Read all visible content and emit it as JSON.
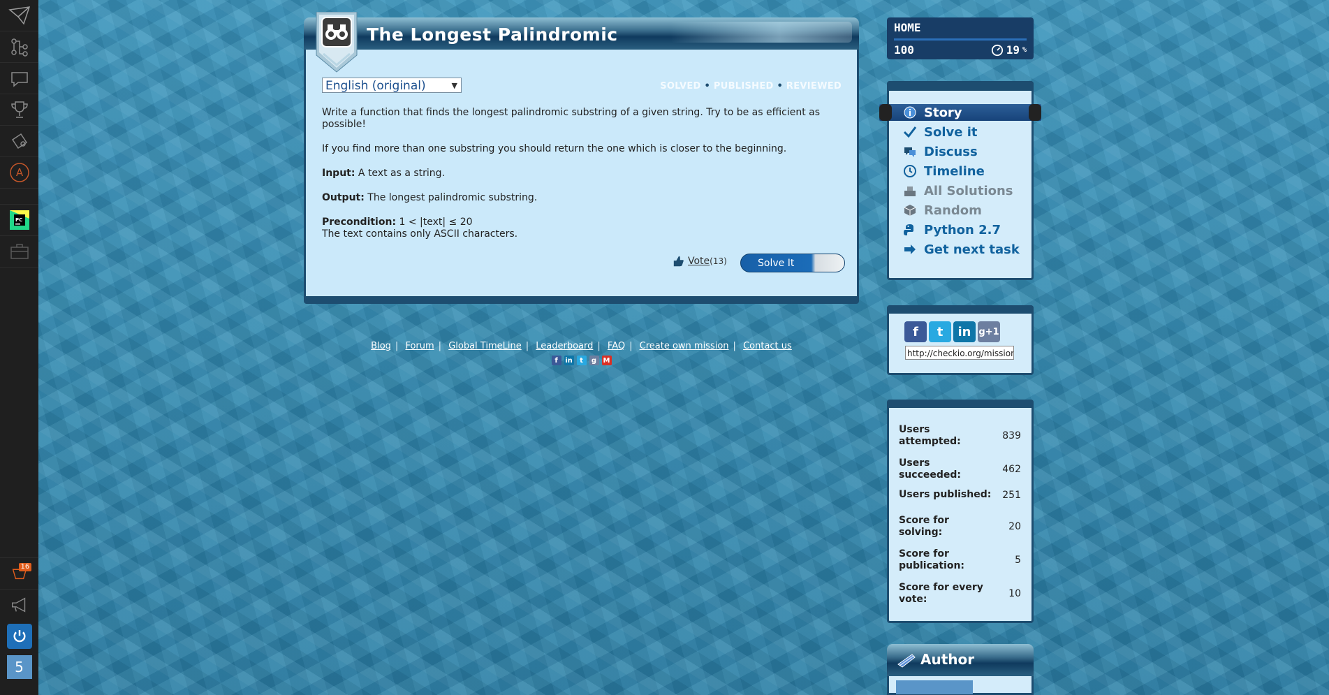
{
  "sidebar": {
    "badge": "16",
    "counter": "5"
  },
  "mission": {
    "title": "The Longest Palindromic",
    "language": "English (original)",
    "status": [
      "SOLVED",
      "PUBLISHED",
      "REVIEWED"
    ],
    "status_sep": "•",
    "p1": "Write a function that finds the longest palindromic substring of a given string. Try to be as efficient as possible!",
    "p2": "If you find more than one substring you should return the one which is closer to the beginning.",
    "input_label": "Input:",
    "input_text": " A text as a string.",
    "output_label": "Output:",
    "output_text": " The longest palindromic substring.",
    "precondition_label": "Precondition:",
    "precondition_text": " 1 < |text| ≤ 20",
    "precondition_line2": "The text contains only ASCII characters.",
    "vote_label": "Vote",
    "vote_count": "(13)",
    "solve_label": "Solve It"
  },
  "footer": {
    "links": [
      "Blog",
      "Forum",
      "Global TimeLine",
      "Leaderboard",
      "FAQ",
      "Create own mission",
      "Contact us"
    ],
    "sep": "|"
  },
  "home": {
    "label": "HOME",
    "score": "100",
    "percent": "19",
    "percent_unit": "%"
  },
  "nav": {
    "items": [
      "Story",
      "Solve it",
      "Discuss",
      "Timeline",
      "All Solutions",
      "Random",
      "Python 2.7",
      "Get next task"
    ]
  },
  "share": {
    "url": "http://checkio.org/mission/"
  },
  "stats": {
    "rows": [
      {
        "label": "Users attempted:",
        "value": "839"
      },
      {
        "label": "Users succeeded:",
        "value": "462"
      },
      {
        "label": "Users published:",
        "value": "251"
      },
      {
        "label": "Score for solving:",
        "value": "20"
      },
      {
        "label": "Score for publication:",
        "value": "5"
      },
      {
        "label": "Score for every vote:",
        "value": "10"
      }
    ]
  },
  "author": {
    "title": "Author"
  },
  "colors": {
    "accent": "#11629e",
    "panel": "#cbe9fa",
    "frame": "#1d4d70"
  }
}
